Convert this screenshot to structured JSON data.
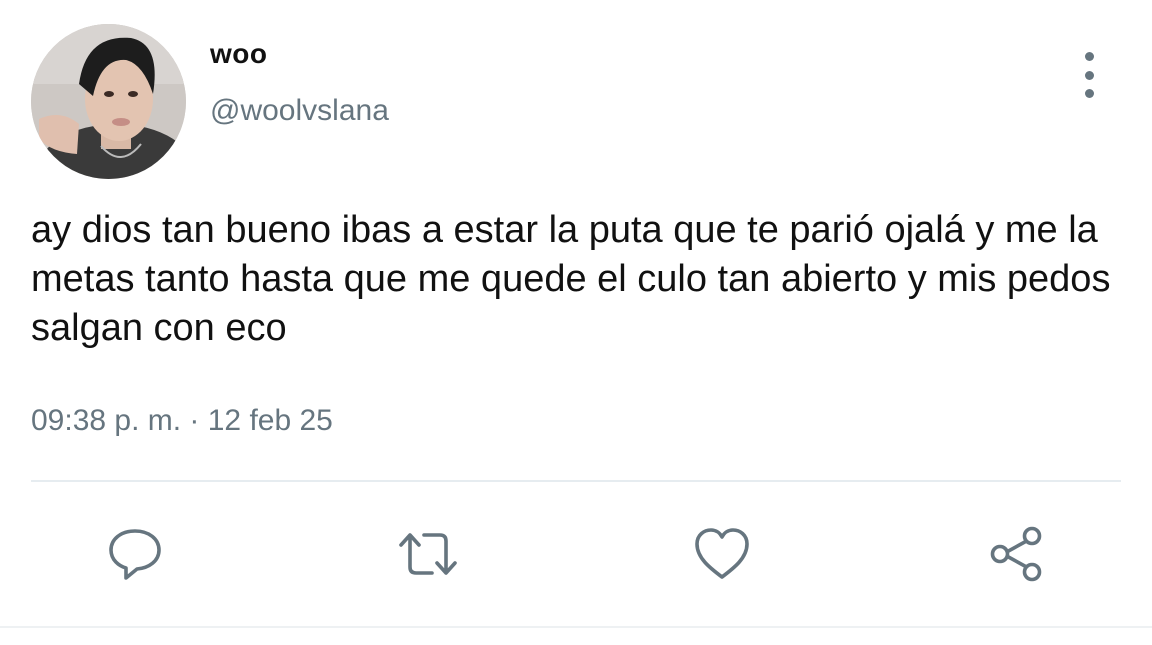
{
  "user": {
    "display_name": "woo",
    "handle": "@woolvslana"
  },
  "tweet": {
    "text": "ay dios tan bueno ibas a estar la puta que te parió ojalá y me la metas tanto hasta que me quede el culo tan abierto y mis pedos salgan con eco",
    "timestamp": "09:38 p. m. · 12 feb 25"
  },
  "actions": [
    {
      "icon": "reply-icon"
    },
    {
      "icon": "retweet-icon"
    },
    {
      "icon": "heart-icon"
    },
    {
      "icon": "share-icon"
    }
  ],
  "colors": {
    "text": "#111111",
    "secondary": "#66757f",
    "divider": "#e6ecf0",
    "icon": "#66757f"
  }
}
